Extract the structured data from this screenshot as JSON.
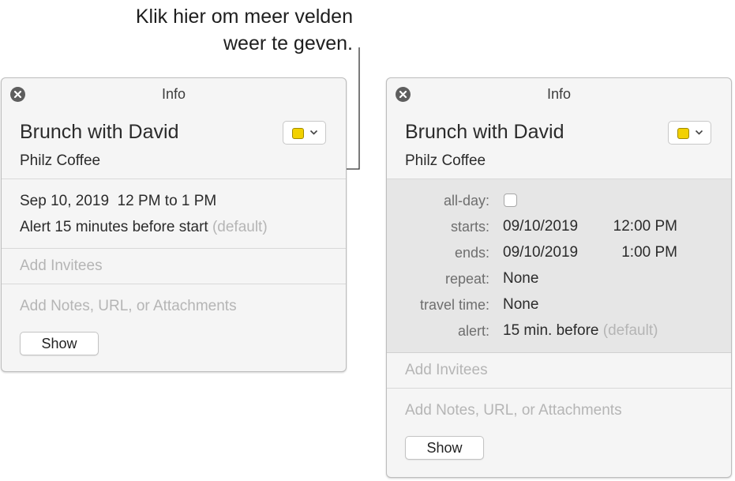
{
  "callout": {
    "line1": "Klik hier om meer velden",
    "line2": "weer te geven."
  },
  "colors": {
    "calendar_swatch": "#f2d100",
    "panel_bg": "#f5f5f5",
    "expanded_bg": "#e6e6e6",
    "placeholder_text": "#b5b5b5"
  },
  "left_panel": {
    "title": "Info",
    "event_title": "Brunch with David",
    "location": "Philz Coffee",
    "date_line": "Sep 10, 2019  12 PM to 1 PM",
    "alert_text": "Alert 15 minutes before start",
    "alert_default": "(default)",
    "invitees_placeholder": "Add Invitees",
    "notes_placeholder": "Add Notes, URL, or Attachments",
    "show_label": "Show"
  },
  "right_panel": {
    "title": "Info",
    "event_title": "Brunch with David",
    "location": "Philz Coffee",
    "fields": {
      "allday_label": "all-day:",
      "starts_label": "starts:",
      "starts_date": "09/10/2019",
      "starts_time": "12:00 PM",
      "ends_label": "ends:",
      "ends_date": "09/10/2019",
      "ends_time": "1:00 PM",
      "repeat_label": "repeat:",
      "repeat_value": "None",
      "travel_label": "travel time:",
      "travel_value": "None",
      "alert_label": "alert:",
      "alert_value": "15 min. before",
      "alert_default": "(default)"
    },
    "invitees_placeholder": "Add Invitees",
    "notes_placeholder": "Add Notes, URL, or Attachments",
    "show_label": "Show"
  }
}
